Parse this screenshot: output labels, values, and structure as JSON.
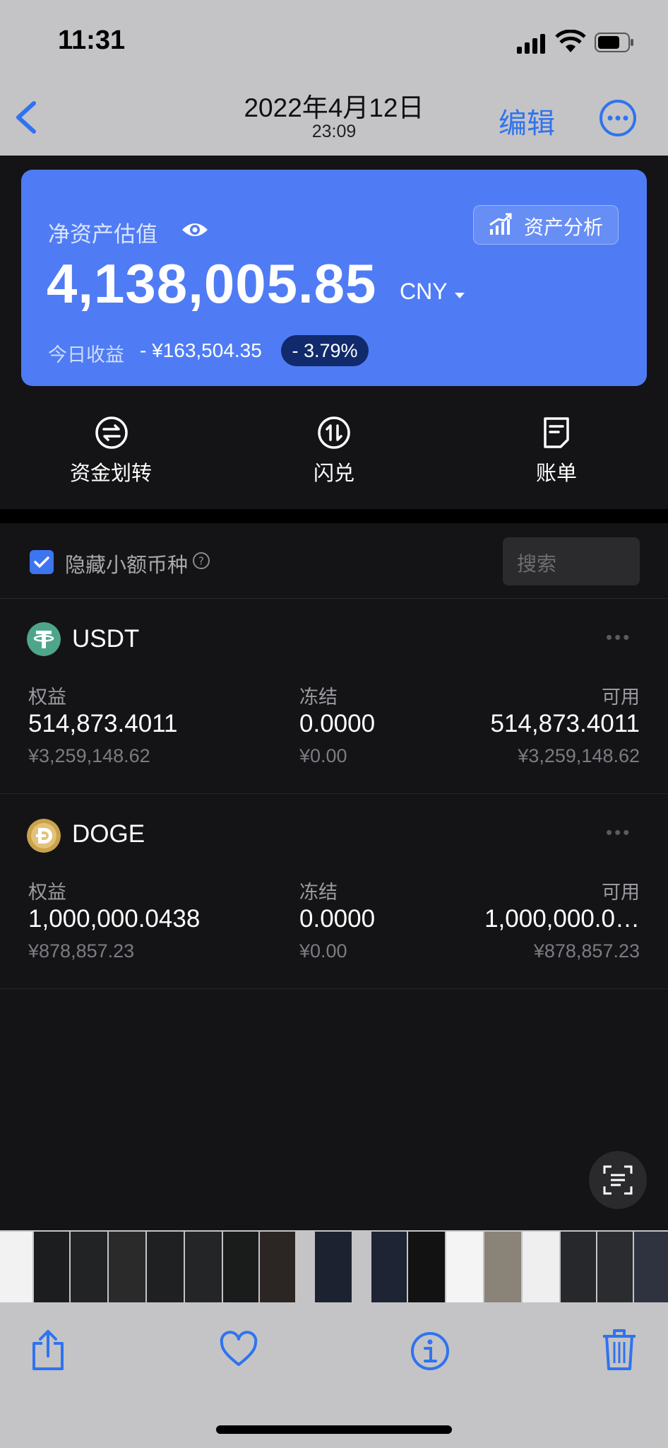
{
  "status_bar": {
    "time": "11:31"
  },
  "nav": {
    "date": "2022年4月12日",
    "time": "23:09",
    "edit_label": "编辑"
  },
  "asset_card": {
    "label": "净资产估值",
    "analysis_label": "资产分析",
    "total": "4,138,005.85",
    "currency": "CNY",
    "today_label": "今日收益",
    "today_value": "- ¥163,504.35",
    "today_pct": "- 3.79%"
  },
  "quick_actions": [
    {
      "label": "资金划转",
      "icon": "transfer-icon"
    },
    {
      "label": "闪兑",
      "icon": "swap-icon"
    },
    {
      "label": "账单",
      "icon": "bill-icon"
    }
  ],
  "filter": {
    "hide_small_label": "隐藏小额币种",
    "hide_small_checked": true,
    "search_placeholder": "搜索"
  },
  "columns": {
    "equity": "权益",
    "frozen": "冻结",
    "available": "可用"
  },
  "coins": [
    {
      "name": "USDT",
      "equity": "514,873.4011",
      "equity_cny": "¥3,259,148.62",
      "frozen": "0.0000",
      "frozen_cny": "¥0.00",
      "available": "514,873.4011",
      "available_cny": "¥3,259,148.62"
    },
    {
      "name": "DOGE",
      "equity": "1,000,000.0438",
      "equity_cny": "¥878,857.23",
      "frozen": "0.0000",
      "frozen_cny": "¥0.00",
      "available": "1,000,000.0…",
      "available_cny": "¥878,857.23"
    }
  ],
  "colors": {
    "accent": "#4f7cf4",
    "ios_blue": "#2f73f0",
    "usdt": "#4fa58a",
    "doge": "#c9a24a"
  }
}
